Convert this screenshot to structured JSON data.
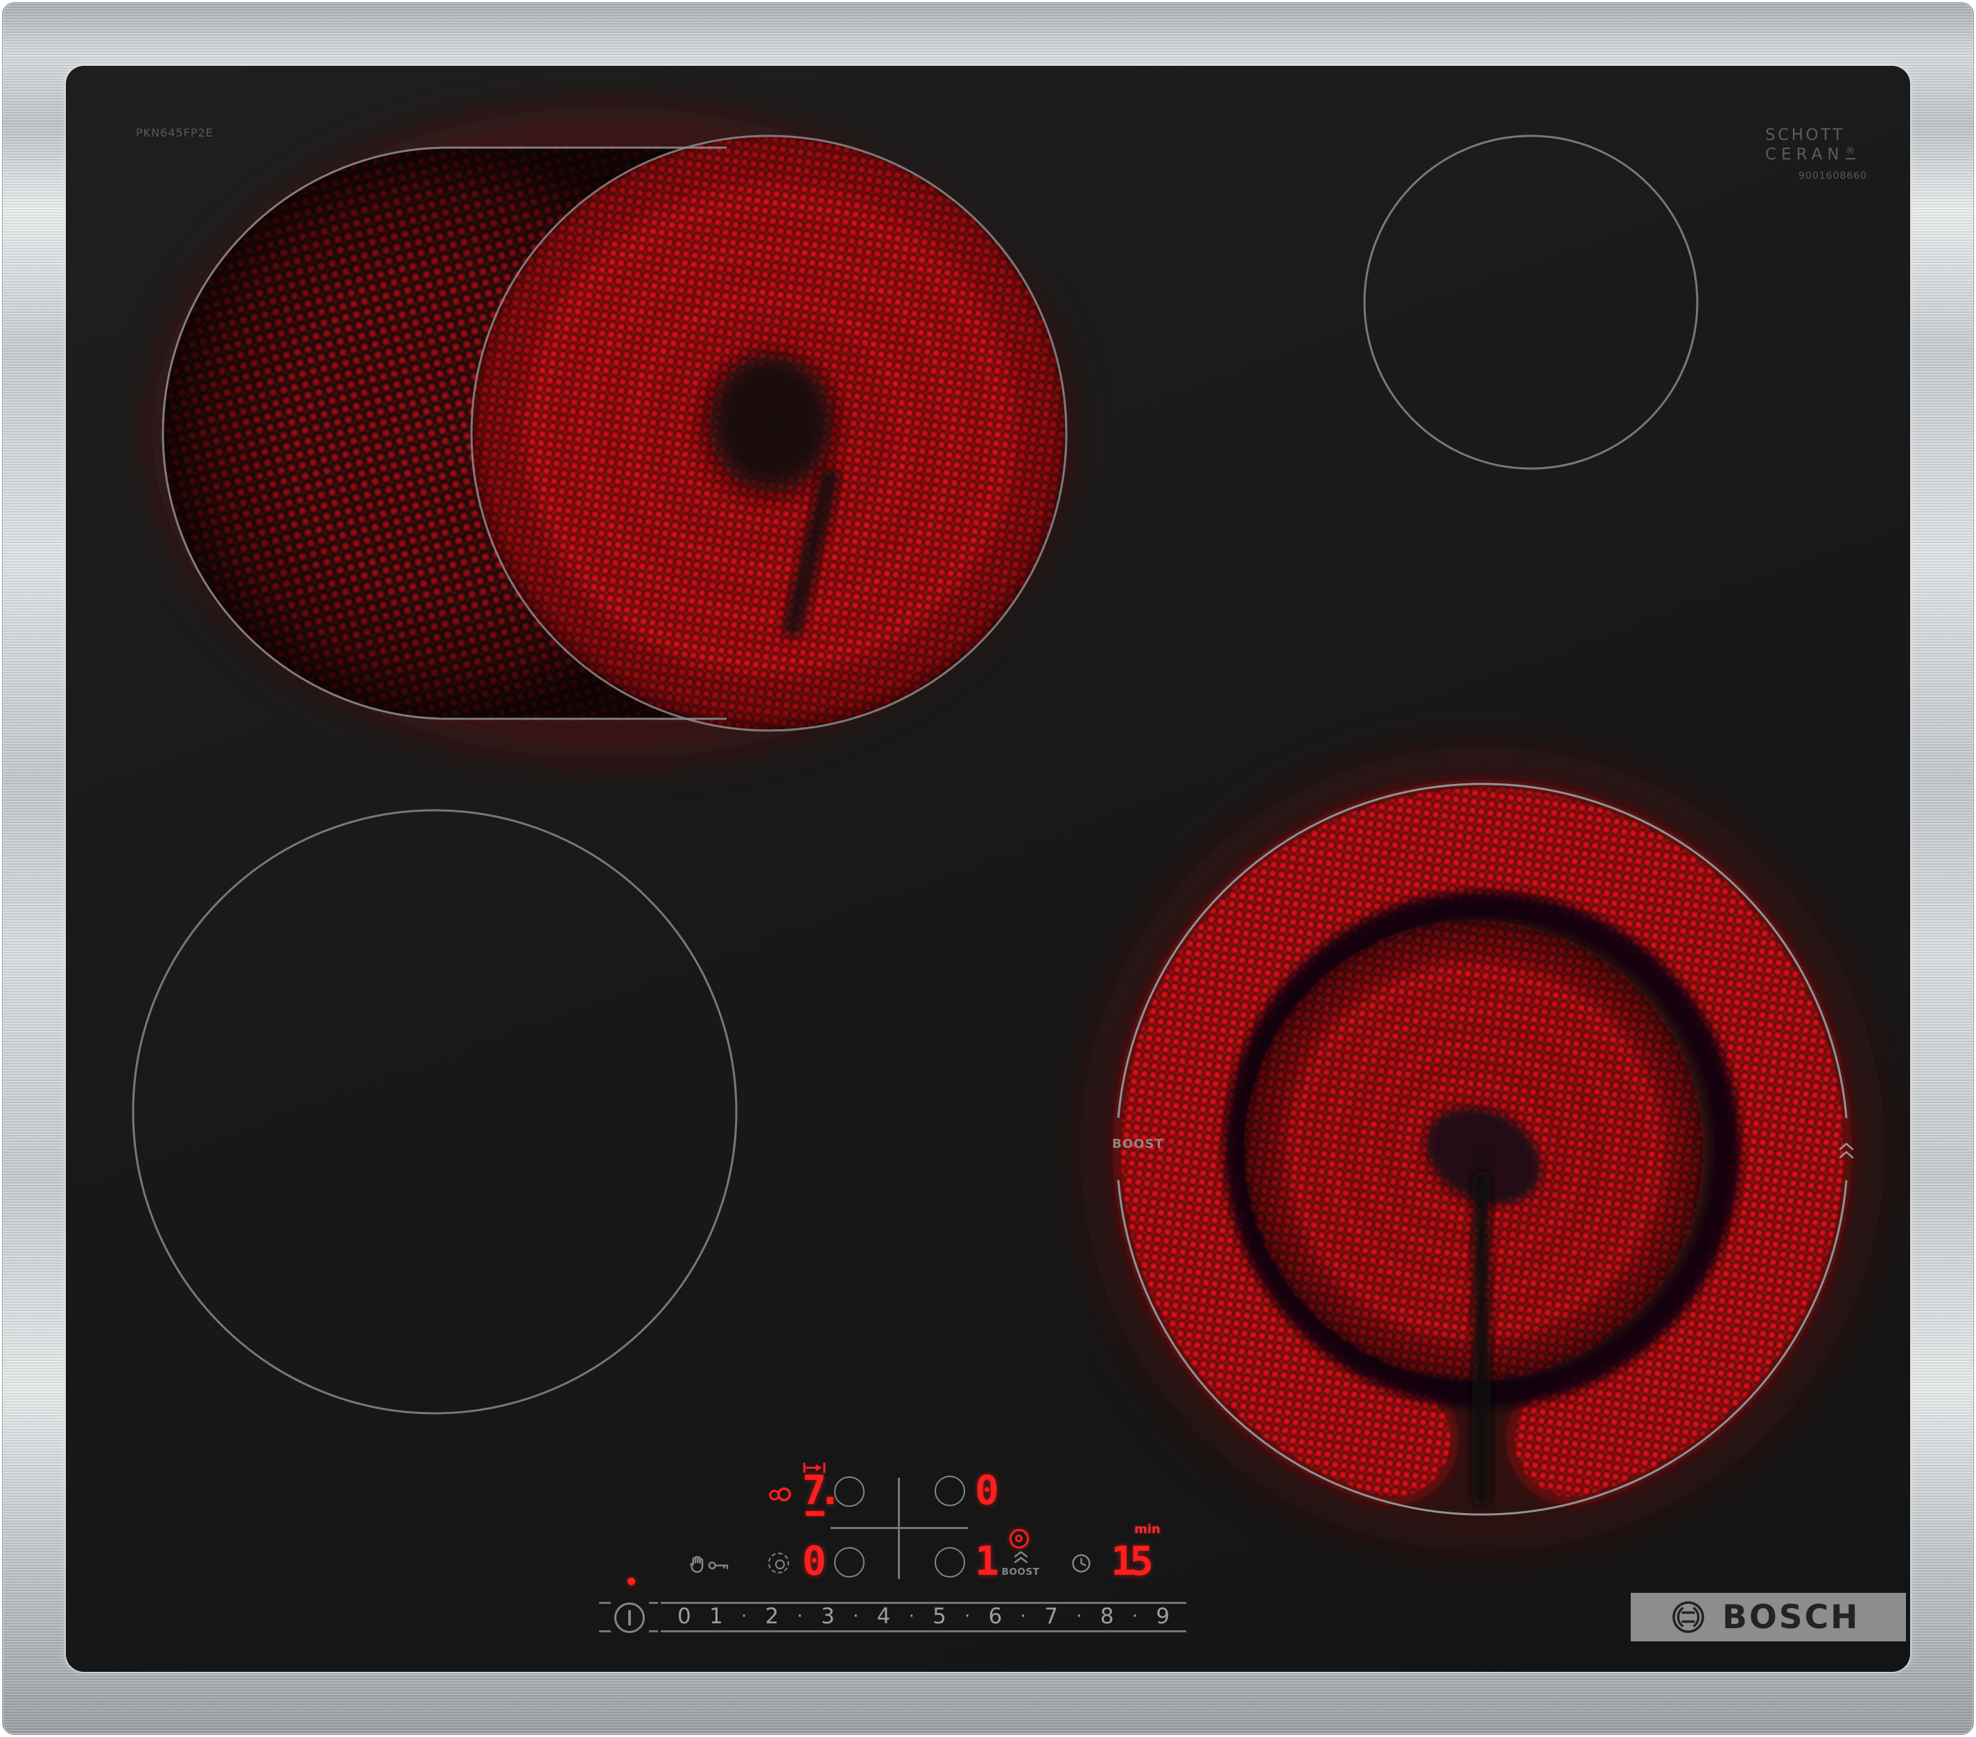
{
  "branding": {
    "model": "PKN645FP2E",
    "glass_brand_line1": "SCHOTT",
    "glass_brand_line2": "CERAN",
    "registered_mark": "®",
    "serial_number": "9001608660",
    "manufacturer": "BOSCH"
  },
  "surface": {
    "boost_label": "BOOST"
  },
  "panel": {
    "displays": {
      "back_left_level": "7.",
      "back_right_level": "0",
      "front_left_level": "0",
      "front_right_level": "1",
      "timer_value": "15",
      "timer_unit": "min"
    },
    "boost_label": "BOOST",
    "slider_levels": [
      "0",
      "1",
      "2",
      "3",
      "4",
      "5",
      "6",
      "7",
      "8",
      "9"
    ],
    "slider_separator": "·"
  },
  "zones": {
    "back_left": {
      "status": "on",
      "type": "dual-extension-zone"
    },
    "back_right": {
      "status": "off",
      "type": "single-zone"
    },
    "front_left": {
      "status": "off",
      "type": "single-zone"
    },
    "front_right": {
      "status": "on",
      "type": "dual-ring-zone"
    }
  },
  "colors": {
    "display_red": "#ff1d1d",
    "glow_red": "#ee1118",
    "icon_gray": "#82868a",
    "steel_light": "#e9eced",
    "logo_plate_gray": "#8d8d8f",
    "glass_black": "#1a1a1a"
  }
}
